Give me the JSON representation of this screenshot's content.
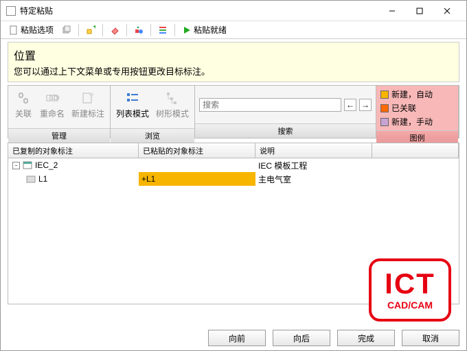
{
  "window": {
    "title": "特定粘贴"
  },
  "toolbar": {
    "paste_options": "粘贴选项",
    "paste_ready": "粘贴就绪"
  },
  "info": {
    "title": "位置",
    "desc": "您可以通过上下文菜单或专用按钮更改目标标注。"
  },
  "ribbon": {
    "manage": {
      "label": "管理",
      "link": "关联",
      "rename": "重命名",
      "new_tag": "新建标注"
    },
    "browse": {
      "label": "浏览",
      "list": "列表模式",
      "tree": "树形模式"
    },
    "search": {
      "label": "搜索",
      "placeholder": "搜索"
    },
    "legend": {
      "label": "图例",
      "items": [
        {
          "color": "#f7b500",
          "text": "新建，自动"
        },
        {
          "color": "#ff6a00",
          "text": "已关联"
        },
        {
          "color": "#c9a3d4",
          "text": "新建，手动"
        }
      ]
    }
  },
  "table": {
    "headers": [
      "已复制的对象标注",
      "已粘贴的对象标注",
      "说明",
      ""
    ],
    "rows": [
      {
        "indent": 0,
        "expand": "-",
        "icon": "project",
        "c0": "IEC_2",
        "c1": "",
        "c2": "IEC 模板工程",
        "hl": false
      },
      {
        "indent": 1,
        "expand": "",
        "icon": "folder",
        "c0": "L1",
        "c1": "+L1",
        "c2": "主电气室",
        "hl": true
      }
    ]
  },
  "footer": {
    "prev": "向前",
    "next": "向后",
    "finish": "完成",
    "cancel": "取消"
  },
  "logo": {
    "big": "ICT",
    "sub": "CAD/CAM"
  }
}
